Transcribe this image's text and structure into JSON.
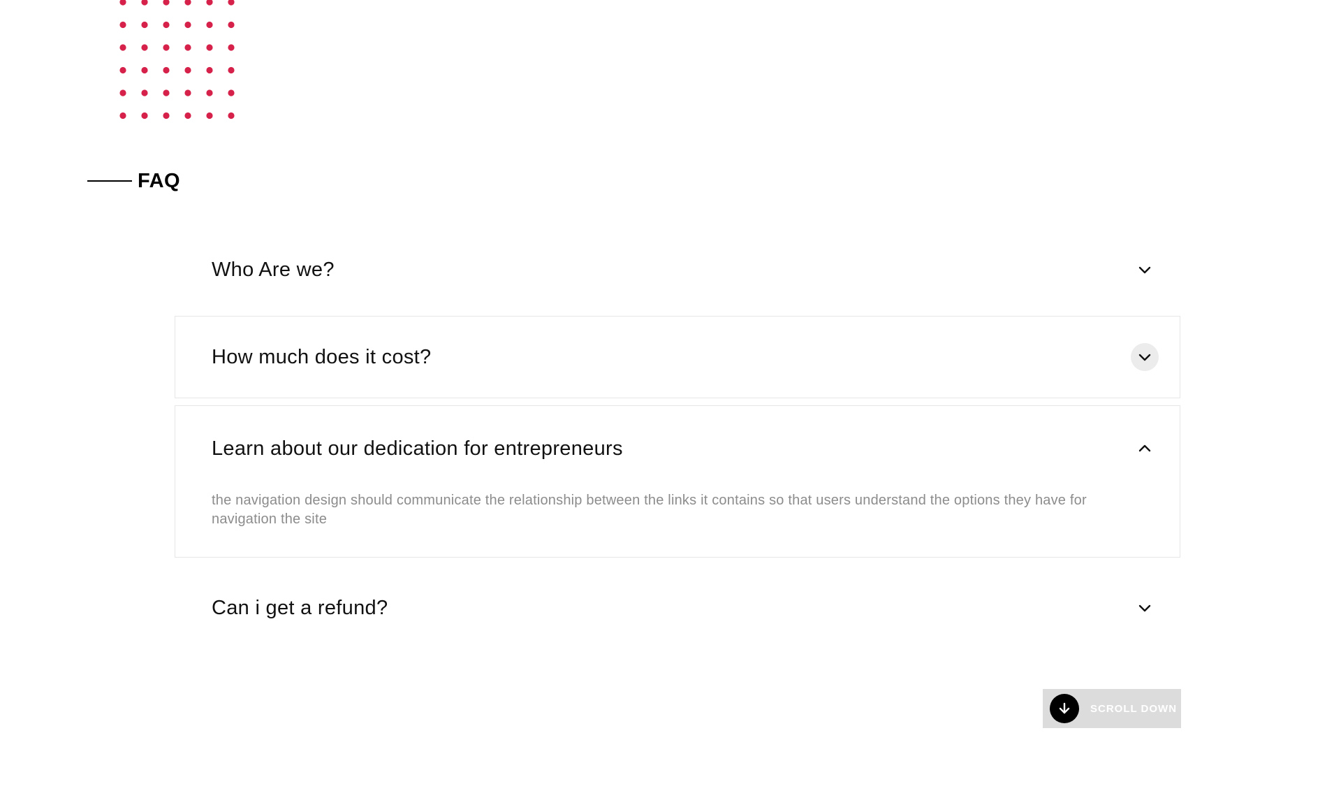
{
  "colors": {
    "accent_dots": "#d6224a",
    "text_primary": "#111111",
    "text_muted": "#8c8c8c",
    "border": "#e6e6e6",
    "scroll_button_bg": "#dcdcdc"
  },
  "faq": {
    "heading": "FAQ",
    "items": [
      {
        "question": "Who Are we?",
        "expanded": false,
        "toggle_icon": "chevron-down-icon"
      },
      {
        "question": "How much does it cost?",
        "expanded": false,
        "toggle_icon": "chevron-down-icon"
      },
      {
        "question": "Learn about our dedication for entrepreneurs",
        "expanded": true,
        "toggle_icon": "chevron-up-icon",
        "answer": "the navigation design should communicate the relationship between the links it contains so that users understand the options they have for navigation the site"
      },
      {
        "question": "Can i get a refund?",
        "expanded": false,
        "toggle_icon": "chevron-down-icon"
      }
    ]
  },
  "scroll_button": {
    "label": "SCROLL DOWN",
    "icon": "arrow-down-icon"
  }
}
